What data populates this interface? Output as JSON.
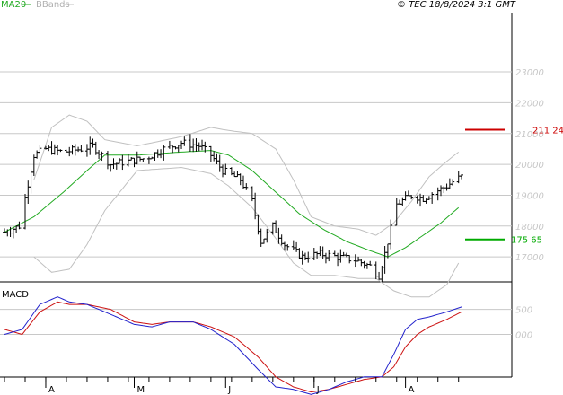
{
  "header": {
    "legend_ma": "MA20",
    "legend_bb": "BBands",
    "copyright": "© TEC 18/8/2024 3:1 GMT"
  },
  "colors": {
    "price_bars": "#000000",
    "ma20": "#22aa22",
    "bbands": "#c0c0c0",
    "macd_line": "#2222cc",
    "signal_line": "#cc1111",
    "resistance": "#cc0000",
    "support": "#00aa00",
    "grid": "#c8c8c8"
  },
  "chart_data": [
    {
      "type": "line",
      "name": "price",
      "ylim": [
        16000,
        23500
      ],
      "yticks": [
        17000,
        18000,
        19000,
        20000,
        21000,
        22000,
        23000
      ],
      "ytick_labels": [
        "17000",
        "18000",
        "19000",
        "20000",
        "21000",
        "22000",
        "23000"
      ],
      "xtick_labels": [
        "A",
        "M",
        "J",
        "J",
        "A"
      ],
      "xtick_days": [
        14,
        44,
        75,
        105,
        136
      ],
      "n_days": 156,
      "close_knots": [
        [
          0,
          17800
        ],
        [
          5,
          18000
        ],
        [
          10,
          20300
        ],
        [
          14,
          20500
        ],
        [
          20,
          20400
        ],
        [
          26,
          20500
        ],
        [
          30,
          20600
        ],
        [
          36,
          20000
        ],
        [
          42,
          20100
        ],
        [
          48,
          20200
        ],
        [
          54,
          20500
        ],
        [
          60,
          20700
        ],
        [
          66,
          20600
        ],
        [
          70,
          20300
        ],
        [
          74,
          19800
        ],
        [
          80,
          19500
        ],
        [
          84,
          18800
        ],
        [
          87,
          17500
        ],
        [
          91,
          18000
        ],
        [
          95,
          17400
        ],
        [
          101,
          17000
        ],
        [
          107,
          17100
        ],
        [
          113,
          17000
        ],
        [
          119,
          16900
        ],
        [
          124,
          16700
        ],
        [
          127,
          16400
        ],
        [
          129,
          17100
        ],
        [
          133,
          18700
        ],
        [
          138,
          19000
        ],
        [
          142,
          18900
        ],
        [
          146,
          19100
        ],
        [
          150,
          19300
        ],
        [
          153,
          19500
        ],
        [
          155,
          19600
        ]
      ],
      "ma20_knots": [
        [
          0,
          17800
        ],
        [
          10,
          18300
        ],
        [
          20,
          19100
        ],
        [
          28,
          19800
        ],
        [
          34,
          20300
        ],
        [
          45,
          20300
        ],
        [
          60,
          20400
        ],
        [
          70,
          20450
        ],
        [
          76,
          20300
        ],
        [
          84,
          19800
        ],
        [
          92,
          19100
        ],
        [
          100,
          18400
        ],
        [
          108,
          17900
        ],
        [
          116,
          17500
        ],
        [
          124,
          17200
        ],
        [
          130,
          17000
        ],
        [
          136,
          17300
        ],
        [
          142,
          17700
        ],
        [
          148,
          18100
        ],
        [
          154,
          18600
        ]
      ],
      "bb_upper_knots": [
        [
          10,
          19500
        ],
        [
          16,
          21200
        ],
        [
          22,
          21600
        ],
        [
          28,
          21400
        ],
        [
          34,
          20800
        ],
        [
          45,
          20600
        ],
        [
          60,
          20900
        ],
        [
          70,
          21200
        ],
        [
          76,
          21100
        ],
        [
          84,
          21000
        ],
        [
          92,
          20500
        ],
        [
          98,
          19500
        ],
        [
          104,
          18300
        ],
        [
          112,
          18000
        ],
        [
          120,
          17900
        ],
        [
          126,
          17700
        ],
        [
          132,
          18100
        ],
        [
          138,
          18800
        ],
        [
          144,
          19600
        ],
        [
          150,
          20100
        ],
        [
          154,
          20400
        ]
      ],
      "bb_lower_knots": [
        [
          10,
          17000
        ],
        [
          16,
          16500
        ],
        [
          22,
          16600
        ],
        [
          28,
          17400
        ],
        [
          34,
          18500
        ],
        [
          45,
          19800
        ],
        [
          60,
          19900
        ],
        [
          70,
          19700
        ],
        [
          76,
          19300
        ],
        [
          84,
          18600
        ],
        [
          92,
          17600
        ],
        [
          98,
          16800
        ],
        [
          104,
          16400
        ],
        [
          112,
          16400
        ],
        [
          120,
          16300
        ],
        [
          126,
          16300
        ],
        [
          132,
          15900
        ],
        [
          138,
          15700
        ],
        [
          144,
          15700
        ],
        [
          150,
          16100
        ],
        [
          154,
          16800
        ]
      ],
      "resistance": {
        "value": 21124,
        "label": "211 24"
      },
      "support": {
        "value": 17565,
        "label": "175 65"
      }
    },
    {
      "type": "line",
      "name": "MACD",
      "title": "MACD",
      "ylim": [
        -1400,
        800
      ],
      "yticks": [
        500,
        0
      ],
      "ytick_labels": [
        "500",
        "000"
      ],
      "series": [
        {
          "key": "macd",
          "knots": [
            [
              0,
              0
            ],
            [
              6,
              100
            ],
            [
              12,
              600
            ],
            [
              18,
              750
            ],
            [
              22,
              650
            ],
            [
              28,
              600
            ],
            [
              36,
              400
            ],
            [
              44,
              200
            ],
            [
              50,
              150
            ],
            [
              56,
              250
            ],
            [
              64,
              250
            ],
            [
              70,
              100
            ],
            [
              78,
              -200
            ],
            [
              86,
              -700
            ],
            [
              92,
              -1050
            ],
            [
              98,
              -1100
            ],
            [
              104,
              -1200
            ],
            [
              110,
              -1100
            ],
            [
              116,
              -950
            ],
            [
              122,
              -850
            ],
            [
              128,
              -850
            ],
            [
              132,
              -400
            ],
            [
              136,
              100
            ],
            [
              140,
              300
            ],
            [
              144,
              350
            ],
            [
              150,
              450
            ],
            [
              155,
              550
            ]
          ]
        },
        {
          "key": "signal",
          "knots": [
            [
              0,
              100
            ],
            [
              6,
              0
            ],
            [
              12,
              450
            ],
            [
              18,
              650
            ],
            [
              22,
              600
            ],
            [
              28,
              600
            ],
            [
              36,
              500
            ],
            [
              44,
              250
            ],
            [
              50,
              200
            ],
            [
              56,
              250
            ],
            [
              64,
              250
            ],
            [
              70,
              150
            ],
            [
              78,
              -50
            ],
            [
              86,
              -450
            ],
            [
              92,
              -850
            ],
            [
              98,
              -1050
            ],
            [
              104,
              -1150
            ],
            [
              110,
              -1100
            ],
            [
              116,
              -1000
            ],
            [
              122,
              -900
            ],
            [
              128,
              -850
            ],
            [
              132,
              -650
            ],
            [
              136,
              -250
            ],
            [
              140,
              0
            ],
            [
              144,
              150
            ],
            [
              150,
              300
            ],
            [
              155,
              450
            ]
          ]
        }
      ]
    }
  ]
}
